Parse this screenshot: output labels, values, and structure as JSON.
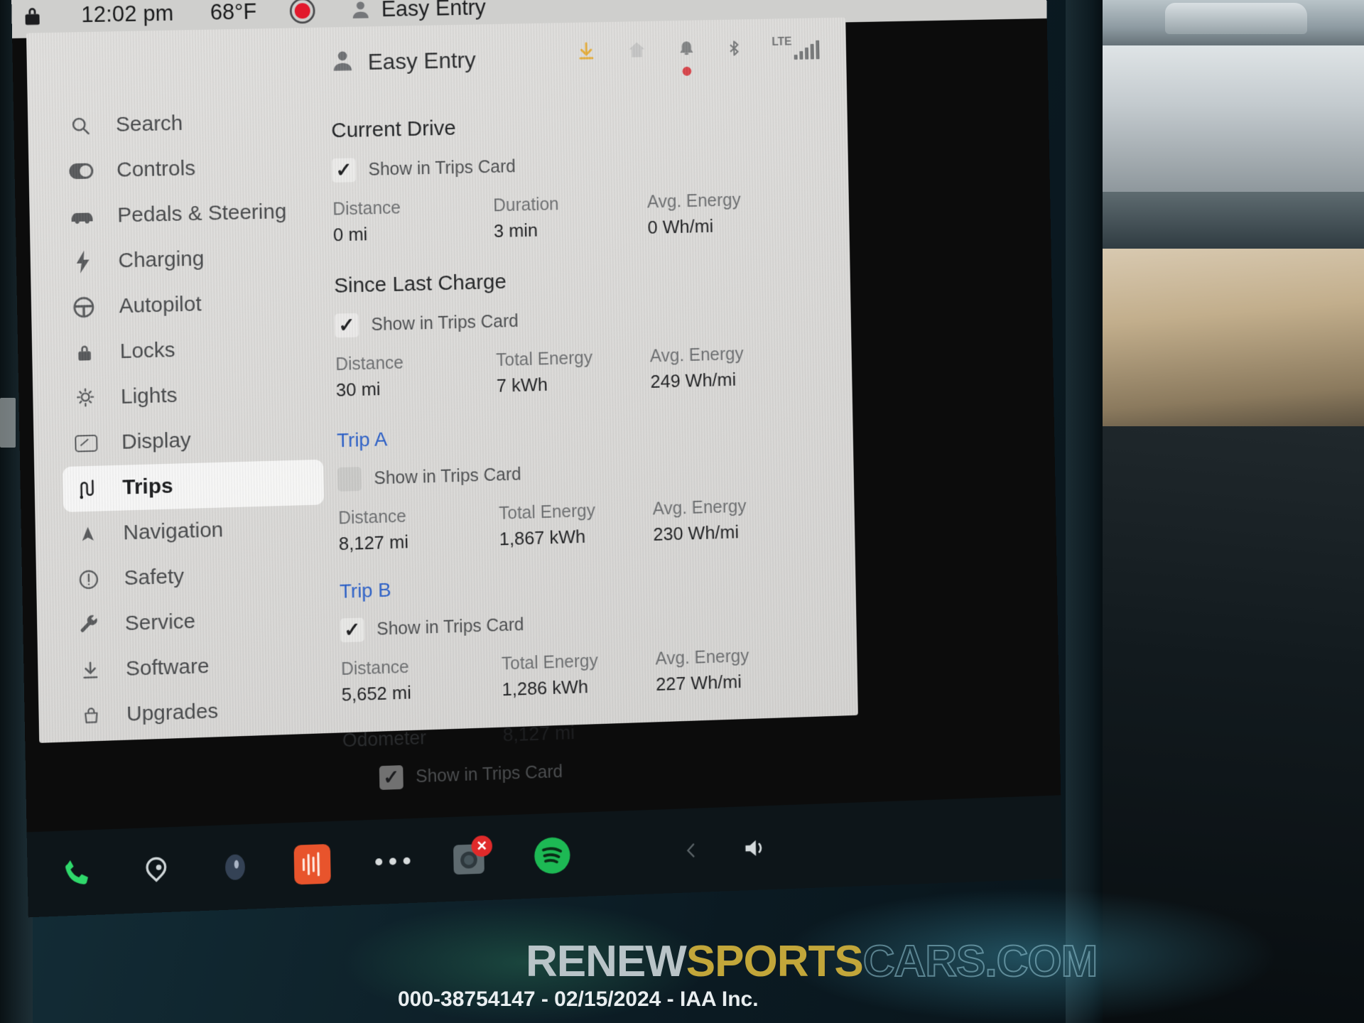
{
  "statusbar": {
    "lock_icon": "lock-icon",
    "time": "12:02 pm",
    "temperature": "68°F",
    "record_icon": "record-indicator-icon",
    "person_icon": "person-icon",
    "profile": "Easy Entry"
  },
  "header": {
    "person_icon": "person-icon",
    "profile_name": "Easy Entry",
    "icons": [
      {
        "name": "software-download-icon",
        "color": "#e8a317"
      },
      {
        "name": "home-location-icon",
        "color": "#c2c2c0"
      },
      {
        "name": "notification-bell-icon",
        "color": "#6f7173",
        "badge_color": "#d7232b"
      },
      {
        "name": "bluetooth-icon",
        "color": "#5f6163"
      },
      {
        "name": "lte-signal-icon",
        "color": "#5f6163",
        "label": "LTE"
      }
    ]
  },
  "sidebar": {
    "items": [
      {
        "label": "Search",
        "icon": "search-icon",
        "active": false
      },
      {
        "label": "Controls",
        "icon": "toggle-icon",
        "active": false
      },
      {
        "label": "Pedals & Steering",
        "icon": "car-icon",
        "active": false
      },
      {
        "label": "Charging",
        "icon": "bolt-icon",
        "active": false
      },
      {
        "label": "Autopilot",
        "icon": "steering-wheel-icon",
        "active": false
      },
      {
        "label": "Locks",
        "icon": "lock-icon",
        "active": false
      },
      {
        "label": "Lights",
        "icon": "lights-icon",
        "active": false
      },
      {
        "label": "Display",
        "icon": "display-icon",
        "active": false
      },
      {
        "label": "Trips",
        "icon": "trips-icon",
        "active": true
      },
      {
        "label": "Navigation",
        "icon": "navigation-arrow-icon",
        "active": false
      },
      {
        "label": "Safety",
        "icon": "safety-icon",
        "active": false
      },
      {
        "label": "Service",
        "icon": "wrench-icon",
        "active": false
      },
      {
        "label": "Software",
        "icon": "download-icon",
        "active": false
      },
      {
        "label": "Upgrades",
        "icon": "upgrades-icon",
        "active": false
      }
    ]
  },
  "trips": {
    "checkbox_label": "Show in Trips Card",
    "sections": [
      {
        "title": "Current Drive",
        "title_style": "plain",
        "checked": true,
        "stats": [
          {
            "label": "Distance",
            "value": "0 mi"
          },
          {
            "label": "Duration",
            "value": "3 min"
          },
          {
            "label": "Avg. Energy",
            "value": "0 Wh/mi"
          }
        ]
      },
      {
        "title": "Since Last Charge",
        "title_style": "plain",
        "checked": true,
        "stats": [
          {
            "label": "Distance",
            "value": "30 mi"
          },
          {
            "label": "Total Energy",
            "value": "7 kWh"
          },
          {
            "label": "Avg. Energy",
            "value": "249 Wh/mi"
          }
        ]
      },
      {
        "title": "Trip A",
        "title_style": "link",
        "checked": false,
        "stats": [
          {
            "label": "Distance",
            "value": "8,127 mi"
          },
          {
            "label": "Total Energy",
            "value": "1,867 kWh"
          },
          {
            "label": "Avg. Energy",
            "value": "230 Wh/mi"
          }
        ]
      },
      {
        "title": "Trip B",
        "title_style": "link",
        "checked": true,
        "stats": [
          {
            "label": "Distance",
            "value": "5,652 mi"
          },
          {
            "label": "Total Energy",
            "value": "1,286 kWh"
          },
          {
            "label": "Avg. Energy",
            "value": "227 Wh/mi"
          }
        ]
      }
    ],
    "odometer": {
      "label": "Odometer",
      "value": "8,127 mi",
      "checked": true,
      "checkbox_label": "Show in Trips Card"
    }
  },
  "taskbar": {
    "items": [
      {
        "name": "phone-icon",
        "color": "#2fd86b"
      },
      {
        "name": "waze-icon",
        "color": "#cfd6d8"
      },
      {
        "name": "voice-orb-icon",
        "color": "#4e5b72"
      },
      {
        "name": "audio-app-icon",
        "color": "#e8542c"
      },
      {
        "name": "more-apps-icon",
        "color": "#d6dadb"
      },
      {
        "name": "camera-icon",
        "color": "#6b7579",
        "badge": "✕",
        "badge_color": "#e02a2a"
      },
      {
        "name": "spotify-icon",
        "color": "#1db954"
      }
    ],
    "volume_icon": "volume-icon",
    "back_chevron_icon": "chevron-left-icon"
  },
  "watermark": {
    "part1": "RENEW",
    "part2": "SPORTS",
    "part3": "CARS.COM",
    "subtitle": "000-38754147 - 02/15/2024 - IAA Inc."
  }
}
